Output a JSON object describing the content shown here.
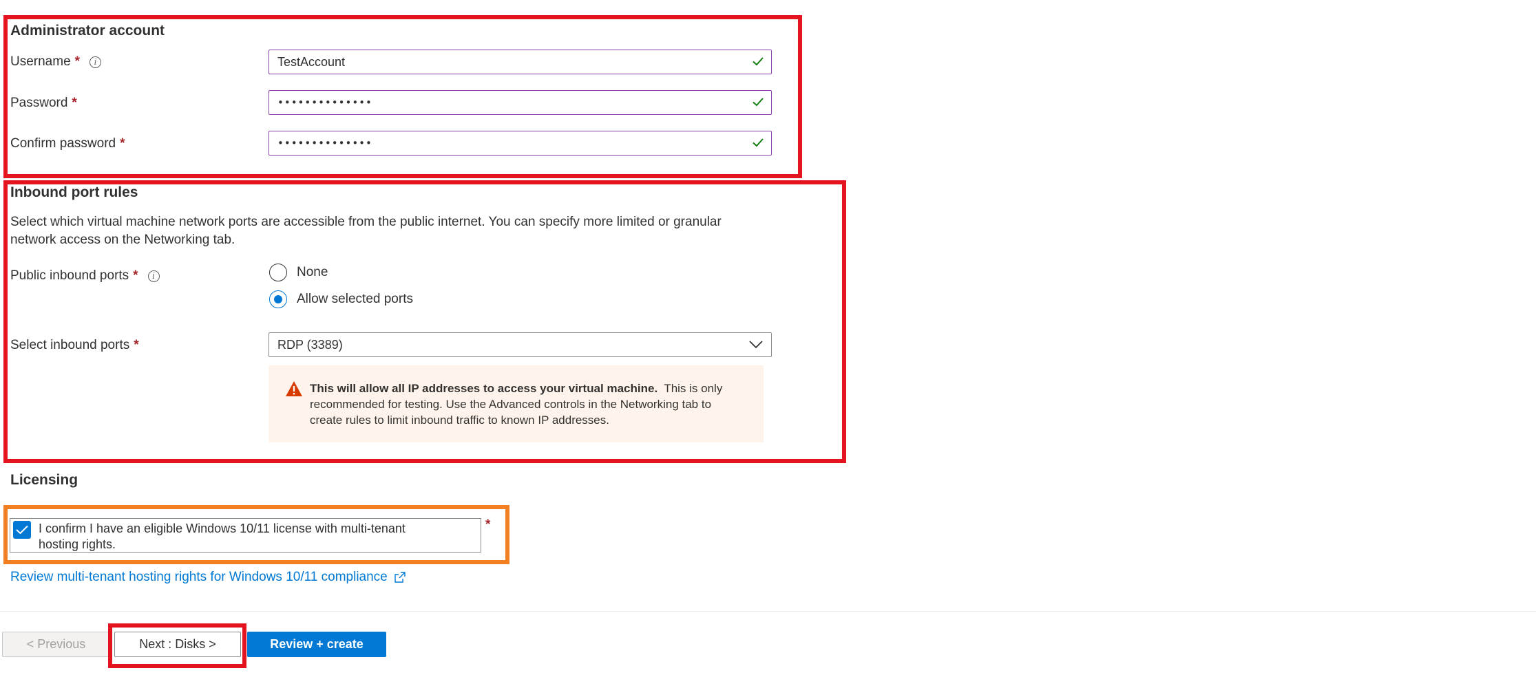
{
  "admin": {
    "title": "Administrator account",
    "username_label": "Username",
    "username_value": "TestAccount",
    "password_label": "Password",
    "password_value": "••••••••••••••",
    "confirm_label": "Confirm password",
    "confirm_value": "••••••••••••••",
    "required_mark": "*"
  },
  "inbound": {
    "title": "Inbound port rules",
    "description": "Select which virtual machine network ports are accessible from the public internet. You can specify more limited or granular network access on the Networking tab.",
    "public_ports_label": "Public inbound ports",
    "options": [
      "None",
      "Allow selected ports"
    ],
    "selected_option": "Allow selected ports",
    "select_ports_label": "Select inbound ports",
    "select_ports_value": "RDP (3389)",
    "warning_bold": "This will allow all IP addresses to access your virtual machine.",
    "warning_text": "This is only recommended for testing.  Use the Advanced controls in the Networking tab to create rules to limit inbound traffic to known IP addresses."
  },
  "licensing": {
    "title": "Licensing",
    "confirm_text": "I confirm I have an eligible Windows 10/11 license with multi-tenant hosting rights.",
    "confirm_checked": true,
    "link_text": "Review multi-tenant hosting rights for Windows 10/11 compliance"
  },
  "footer": {
    "previous_label": "< Previous",
    "next_label": "Next : Disks >",
    "review_label": "Review + create"
  },
  "colors": {
    "accent": "#0078d4",
    "highlight_red": "#e3141f",
    "highlight_orange": "#f28023",
    "valid_green": "#107c10",
    "warning_orange": "#d83b01"
  }
}
